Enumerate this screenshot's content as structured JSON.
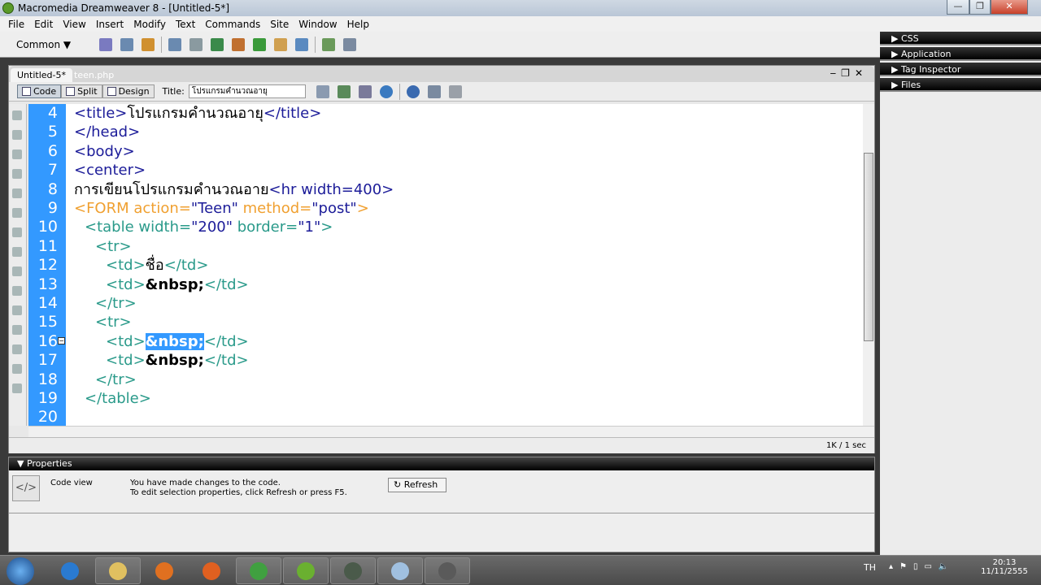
{
  "window": {
    "title": "Macromedia Dreamweaver 8 - [Untitled-5*]",
    "min": "—",
    "max": "❐",
    "close": "✕"
  },
  "menu": [
    "File",
    "Edit",
    "View",
    "Insert",
    "Modify",
    "Text",
    "Commands",
    "Site",
    "Window",
    "Help"
  ],
  "insert_bar": {
    "category": "Common",
    "icons": [
      "hyperlink-icon",
      "email-link-icon",
      "named-anchor-icon",
      "table-icon",
      "layer-icon",
      "image-icon",
      "media-icon",
      "date-icon",
      "server-side-include-icon",
      "comment-icon",
      "head-icon",
      "template-icon"
    ]
  },
  "doc": {
    "tabs": [
      "Untitled-5*",
      "teen.php"
    ],
    "views": [
      "Code",
      "Split",
      "Design"
    ],
    "title_label": "Title:",
    "title_value": "โปรแกรมคำนวณอายุ",
    "status": "1K / 1 sec",
    "lines": [
      {
        "n": "4",
        "indent": 0,
        "seg": [
          [
            "t",
            "<title>"
          ],
          [
            "x",
            "โปรแกรมคำนวณอายุ"
          ],
          [
            "t",
            "</title>"
          ]
        ]
      },
      {
        "n": "5",
        "indent": 0,
        "seg": [
          [
            "t",
            "</head>"
          ]
        ]
      },
      {
        "n": "6",
        "indent": 0,
        "seg": [
          [
            "t",
            "<body>"
          ]
        ]
      },
      {
        "n": "7",
        "indent": 0,
        "seg": [
          [
            "t",
            "<center>"
          ]
        ]
      },
      {
        "n": "8",
        "indent": 0,
        "seg": [
          [
            "x",
            "การเขียนโปรแกรมคำนวณอาย"
          ],
          [
            "t",
            "<hr width=400>"
          ]
        ]
      },
      {
        "n": "9",
        "indent": 0,
        "seg": [
          [
            "f",
            "<FORM action="
          ],
          [
            "t",
            "\"Teen\""
          ],
          [
            "f",
            " method="
          ],
          [
            "t",
            "\"post\""
          ],
          [
            "f",
            ">"
          ]
        ]
      },
      {
        "n": "10",
        "indent": 1,
        "seg": [
          [
            "tb",
            "<table width="
          ],
          [
            "t",
            "\"200\""
          ],
          [
            "tb",
            " border="
          ],
          [
            "t",
            "\"1\""
          ],
          [
            "tb",
            ">"
          ]
        ]
      },
      {
        "n": "11",
        "indent": 2,
        "seg": [
          [
            "tb",
            "<tr>"
          ]
        ]
      },
      {
        "n": "12",
        "indent": 3,
        "seg": [
          [
            "tb",
            "<td>"
          ],
          [
            "x",
            "ชื่อ"
          ],
          [
            "tb",
            "</td>"
          ]
        ]
      },
      {
        "n": "13",
        "indent": 3,
        "seg": [
          [
            "tb",
            "<td>"
          ],
          [
            "b",
            "&nbsp;"
          ],
          [
            "tb",
            "</td>"
          ]
        ]
      },
      {
        "n": "14",
        "indent": 2,
        "seg": [
          [
            "tb",
            "</tr>"
          ]
        ]
      },
      {
        "n": "15",
        "indent": 2,
        "seg": [
          [
            "tb",
            "<tr>"
          ]
        ]
      },
      {
        "n": "16",
        "indent": 3,
        "seg": [
          [
            "tb",
            "<td>"
          ],
          [
            "sel",
            "&nbsp;"
          ],
          [
            "tb",
            "</td>"
          ]
        ]
      },
      {
        "n": "17",
        "indent": 3,
        "seg": [
          [
            "tb",
            "<td>"
          ],
          [
            "b",
            "&nbsp;"
          ],
          [
            "tb",
            "</td>"
          ]
        ]
      },
      {
        "n": "18",
        "indent": 2,
        "seg": [
          [
            "tb",
            "</tr>"
          ]
        ]
      },
      {
        "n": "19",
        "indent": 1,
        "seg": [
          [
            "tb",
            "</table>"
          ]
        ]
      },
      {
        "n": "20",
        "indent": 0,
        "seg": []
      }
    ]
  },
  "properties": {
    "header": "▼ Properties",
    "mode": "Code view",
    "msg1": "You have made changes to the code.",
    "msg2": "To edit selection properties, click Refresh or press F5.",
    "refresh": "Refresh"
  },
  "right_panels": [
    "CSS",
    "Application",
    "Tag Inspector",
    "Files"
  ],
  "taskbar": {
    "apps": [
      "internet-explorer-icon",
      "file-explorer-icon",
      "media-player-icon",
      "firefox-icon",
      "chrome-icon",
      "dreamweaver-icon",
      "app-icon",
      "notepad-icon",
      "app-recording-icon"
    ],
    "lang": "TH",
    "time": "20:13",
    "date": "11/11/2555"
  },
  "colors": {
    "gutter": "#3399ff",
    "tag": "#1c1c99",
    "form_tag": "#f0a030",
    "table_tag": "#2a9a8a"
  }
}
